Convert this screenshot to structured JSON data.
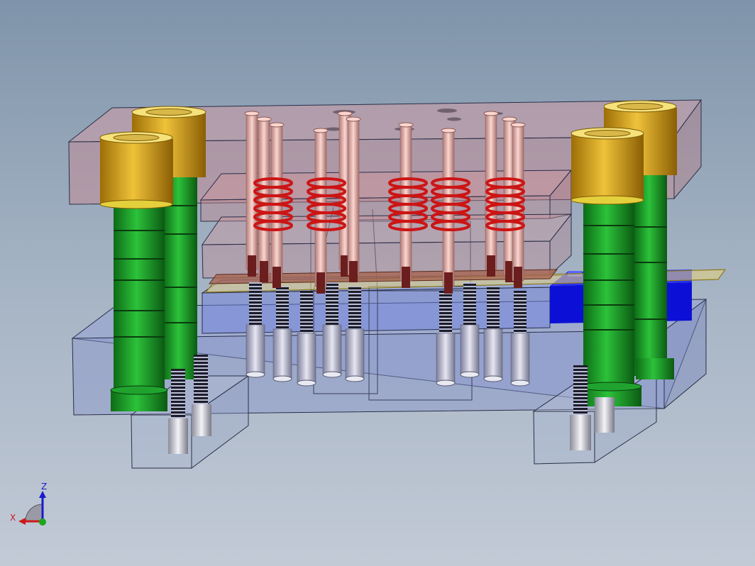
{
  "viewport": {
    "background_top": "#7f94aa",
    "background_bottom": "#c2cad6"
  },
  "model": {
    "colors": {
      "upper_plate": "#c78f98",
      "lower_plate": "#8a98d8",
      "guide_pillar": "#1f9a2a",
      "guide_bushing": "#d7a21a",
      "punch": "#e8b3aa",
      "spring": "#cc1515",
      "block": "#0a0ad0",
      "strip": "#d9c44a",
      "screw": "#d8d8e2"
    }
  },
  "triad": {
    "z_label": "Z",
    "x_label": "X",
    "z_color": "#1a1acc",
    "x_color": "#cc1a1a",
    "y_color": "#1aa81a"
  }
}
